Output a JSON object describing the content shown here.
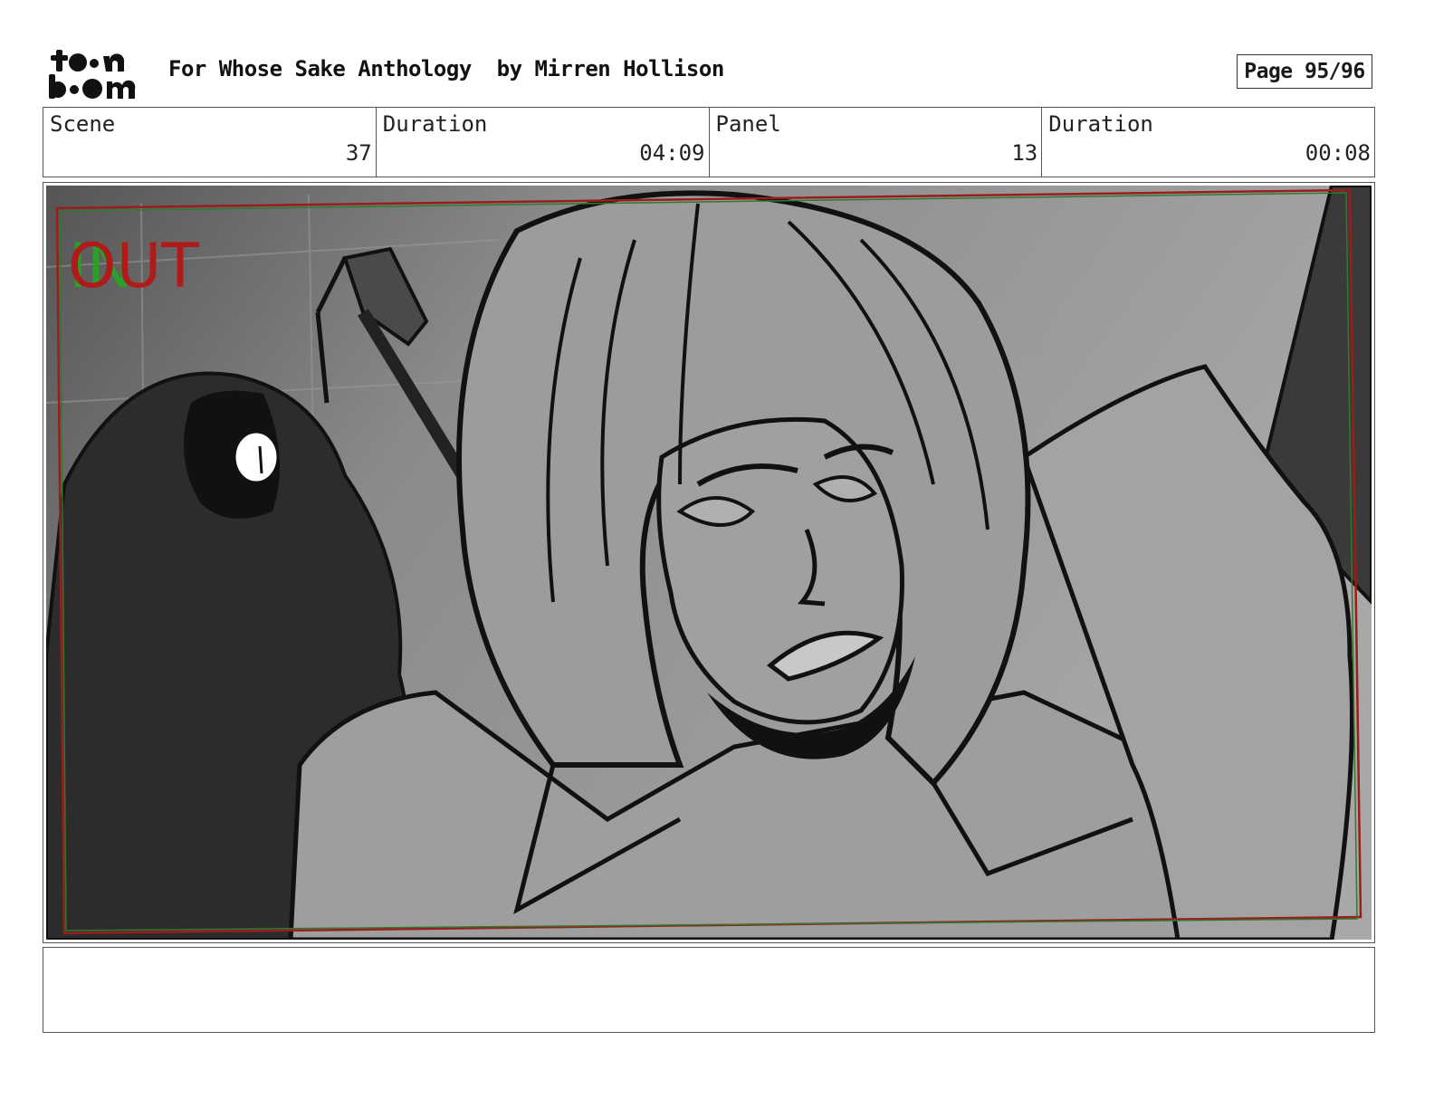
{
  "header": {
    "logo_text_top": "toon",
    "logo_text_bottom": "boom",
    "title": "For Whose Sake Anthology  by Mirren Hollison",
    "page_label": "Page 95/96"
  },
  "info": {
    "scene_label": "Scene",
    "scene_value": "37",
    "duration_label": "Duration",
    "duration_value": "04:09",
    "panel_label": "Panel",
    "panel_value": "13",
    "panel_duration_label": "Duration",
    "panel_duration_value": "00:08"
  },
  "panel": {
    "overlay_text_in": "IN",
    "overlay_text_out": "OUT",
    "colors": {
      "out_red": "#b01a1a",
      "in_green": "#2aa02a",
      "frame_red": "#9b1c1c",
      "frame_green": "#2f7a2f",
      "frame_blue": "#3050a0"
    }
  },
  "notes": {
    "text": ""
  }
}
